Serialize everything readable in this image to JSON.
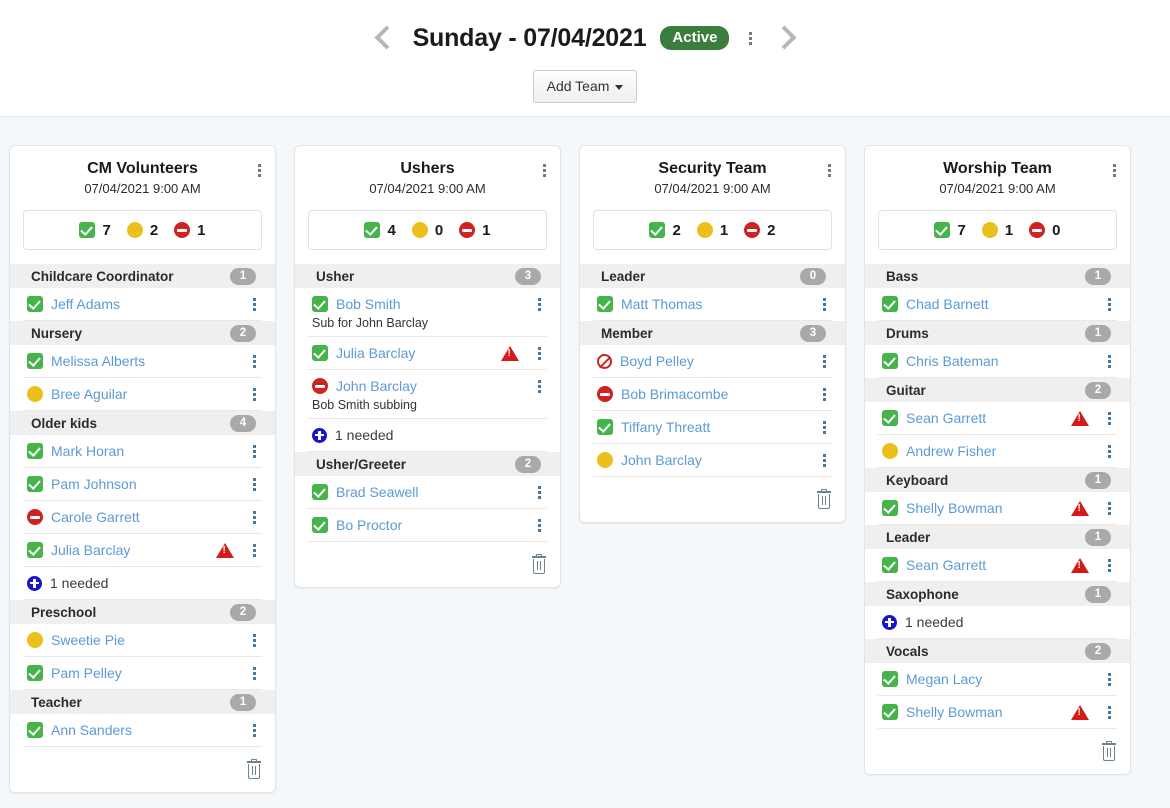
{
  "header": {
    "prev_icon": "chevron-left-icon",
    "next_icon": "chevron-right-icon",
    "title": "Sunday - 07/04/2021",
    "status_badge": "Active",
    "menu_icon": "kebab-menu-icon",
    "add_team_label": "Add Team"
  },
  "colors": {
    "badge_green": "#3a7d3c",
    "status_check": "#45b54b",
    "status_question": "#ecc01c",
    "status_declined": "#cf2222",
    "needed_plus": "#1515cc",
    "warning": "#d61a1a",
    "link": "#5b9bd5",
    "board_bg": "#f5f8fa"
  },
  "teams": [
    {
      "title": "CM Volunteers",
      "datetime": "07/04/2021 9:00 AM",
      "summary": {
        "confirmed": "7",
        "pending": "2",
        "declined": "1"
      },
      "groups": [
        {
          "name": "Childcare Coordinator",
          "count": "1",
          "rows": [
            {
              "status": "check",
              "name": "Jeff Adams",
              "warn": false,
              "note": ""
            }
          ]
        },
        {
          "name": "Nursery",
          "count": "2",
          "rows": [
            {
              "status": "check",
              "name": "Melissa Alberts",
              "warn": false,
              "note": ""
            },
            {
              "status": "question",
              "name": "Bree Aguilar",
              "warn": false,
              "note": ""
            }
          ]
        },
        {
          "name": "Older kids",
          "count": "4",
          "rows": [
            {
              "status": "check",
              "name": "Mark Horan",
              "warn": false,
              "note": ""
            },
            {
              "status": "check",
              "name": "Pam Johnson",
              "warn": false,
              "note": ""
            },
            {
              "status": "minus",
              "name": "Carole Garrett",
              "warn": false,
              "note": ""
            },
            {
              "status": "check",
              "name": "Julia Barclay",
              "warn": true,
              "note": ""
            },
            {
              "status": "needed",
              "name": "1 needed",
              "warn": false,
              "note": ""
            }
          ]
        },
        {
          "name": "Preschool",
          "count": "2",
          "rows": [
            {
              "status": "question",
              "name": "Sweetie Pie",
              "warn": false,
              "note": ""
            },
            {
              "status": "check",
              "name": "Pam Pelley",
              "warn": false,
              "note": ""
            }
          ]
        },
        {
          "name": "Teacher",
          "count": "1",
          "rows": [
            {
              "status": "check",
              "name": "Ann Sanders",
              "warn": false,
              "note": ""
            }
          ]
        }
      ],
      "delete_icon": "trash-icon"
    },
    {
      "title": "Ushers",
      "datetime": "07/04/2021 9:00 AM",
      "summary": {
        "confirmed": "4",
        "pending": "0",
        "declined": "1"
      },
      "groups": [
        {
          "name": "Usher",
          "count": "3",
          "rows": [
            {
              "status": "check",
              "name": "Bob Smith",
              "warn": false,
              "note": "Sub for John Barclay"
            },
            {
              "status": "check",
              "name": "Julia Barclay",
              "warn": true,
              "note": ""
            },
            {
              "status": "minus",
              "name": "John Barclay",
              "warn": false,
              "note": "Bob Smith subbing"
            },
            {
              "status": "needed",
              "name": "1 needed",
              "warn": false,
              "note": ""
            }
          ]
        },
        {
          "name": "Usher/Greeter",
          "count": "2",
          "rows": [
            {
              "status": "check",
              "name": "Brad Seawell",
              "warn": false,
              "note": ""
            },
            {
              "status": "check",
              "name": "Bo Proctor",
              "warn": false,
              "note": ""
            }
          ]
        }
      ],
      "delete_icon": "trash-icon"
    },
    {
      "title": "Security Team",
      "datetime": "07/04/2021 9:00 AM",
      "summary": {
        "confirmed": "2",
        "pending": "1",
        "declined": "2"
      },
      "groups": [
        {
          "name": "Leader",
          "count": "0",
          "rows": [
            {
              "status": "check",
              "name": "Matt Thomas",
              "warn": false,
              "note": ""
            }
          ]
        },
        {
          "name": "Member",
          "count": "3",
          "rows": [
            {
              "status": "ban",
              "name": "Boyd Pelley",
              "warn": false,
              "note": ""
            },
            {
              "status": "minus",
              "name": "Bob Brimacombe",
              "warn": false,
              "note": ""
            },
            {
              "status": "check",
              "name": "Tiffany Threatt",
              "warn": false,
              "note": ""
            },
            {
              "status": "question",
              "name": "John Barclay",
              "warn": false,
              "note": ""
            }
          ]
        }
      ],
      "delete_icon": "trash-icon"
    },
    {
      "title": "Worship Team",
      "datetime": "07/04/2021 9:00 AM",
      "summary": {
        "confirmed": "7",
        "pending": "1",
        "declined": "0"
      },
      "groups": [
        {
          "name": "Bass",
          "count": "1",
          "rows": [
            {
              "status": "check",
              "name": "Chad Barnett",
              "warn": false,
              "note": ""
            }
          ]
        },
        {
          "name": "Drums",
          "count": "1",
          "rows": [
            {
              "status": "check",
              "name": "Chris Bateman",
              "warn": false,
              "note": ""
            }
          ]
        },
        {
          "name": "Guitar",
          "count": "2",
          "rows": [
            {
              "status": "check",
              "name": "Sean Garrett",
              "warn": true,
              "note": ""
            },
            {
              "status": "question",
              "name": "Andrew Fisher",
              "warn": false,
              "note": ""
            }
          ]
        },
        {
          "name": "Keyboard",
          "count": "1",
          "rows": [
            {
              "status": "check",
              "name": "Shelly Bowman",
              "warn": true,
              "note": ""
            }
          ]
        },
        {
          "name": "Leader",
          "count": "1",
          "rows": [
            {
              "status": "check",
              "name": "Sean Garrett",
              "warn": true,
              "note": ""
            }
          ]
        },
        {
          "name": "Saxophone",
          "count": "1",
          "rows": [
            {
              "status": "needed",
              "name": "1 needed",
              "warn": false,
              "note": ""
            }
          ]
        },
        {
          "name": "Vocals",
          "count": "2",
          "rows": [
            {
              "status": "check",
              "name": "Megan Lacy",
              "warn": false,
              "note": ""
            },
            {
              "status": "check",
              "name": "Shelly Bowman",
              "warn": true,
              "note": ""
            }
          ]
        }
      ],
      "delete_icon": "trash-icon"
    }
  ]
}
